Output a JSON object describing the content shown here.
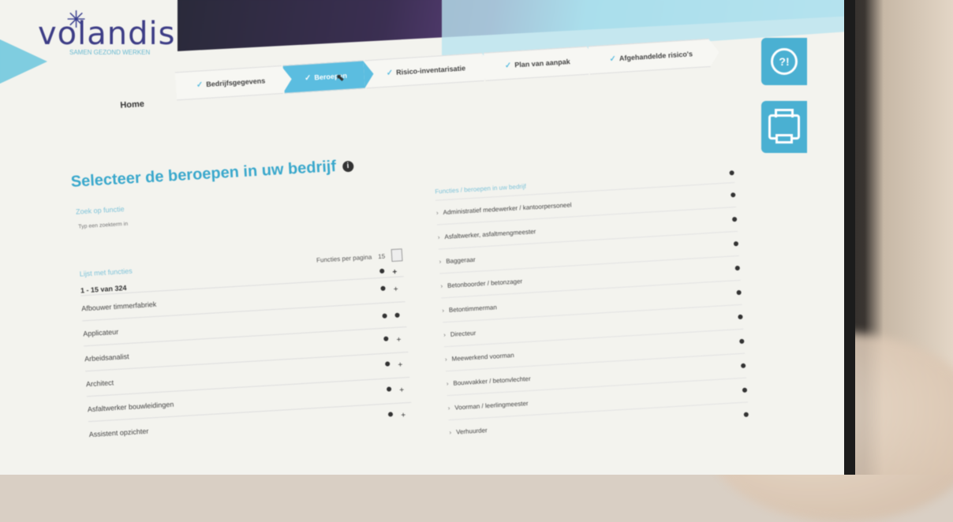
{
  "brand": {
    "name": "volandis",
    "tagline": "SAMEN GEZOND WERKEN"
  },
  "nav": {
    "home": "Home",
    "steps": [
      {
        "label": "Bedrijfsgegevens",
        "active": false
      },
      {
        "label": "Beroepen",
        "active": true
      },
      {
        "label": "Risico-inventarisatie",
        "active": false
      },
      {
        "label": "Plan van aanpak",
        "active": false
      },
      {
        "label": "Afgehandelde risico's",
        "active": false
      }
    ]
  },
  "sidebar_buttons": {
    "help": "?!",
    "print_icon": "printer-icon"
  },
  "main": {
    "title": "Selecteer de beroepen in uw bedrijf",
    "info": "i",
    "search_label": "Zoek op functie",
    "search_placeholder": "Typ een zoekterm in",
    "left": {
      "heading": "Lijst met functies",
      "per_page_label": "Functies per pagina",
      "per_page_value": "15",
      "count_prefix": "1 - 15 van",
      "count_total": "324",
      "rows": [
        "Afbouwer timmerfabriek",
        "Applicateur",
        "Arbeidsanalist",
        "Architect",
        "Asfaltwerker bouwleidingen",
        "Assistent opzichter"
      ]
    },
    "right": {
      "heading": "Functies / beroepen in uw bedrijf",
      "rows": [
        "Administratief medewerker / kantoorpersoneel",
        "Asfaltwerker, asfaltmengmeester",
        "Baggeraar",
        "Betonboorder / betonzager",
        "Betontimmerman",
        "Directeur",
        "Meewerkend voorman",
        "Bouwvakker / betonvlechter",
        "Voorman / leerlingmeester",
        "Verhuurder"
      ]
    }
  },
  "colors": {
    "accent": "#5bbde0",
    "title": "#3aa8cc",
    "logo": "#3d3d86"
  }
}
